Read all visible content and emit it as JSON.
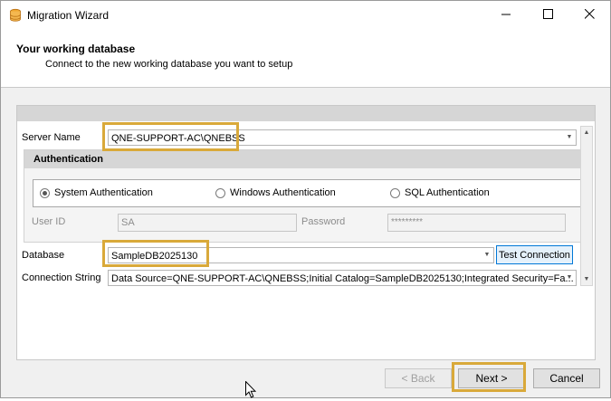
{
  "window": {
    "title": "Migration Wizard"
  },
  "header": {
    "title": "Your working database",
    "subtitle": "Connect to the new working database you want to setup"
  },
  "form": {
    "server_name_label": "Server Name",
    "server_name_value": "QNE-SUPPORT-AC\\QNEBSS",
    "auth_title": "Authentication",
    "auth_options": [
      "System Authentication",
      "Windows Authentication",
      "SQL Authentication"
    ],
    "auth_selected": "System Authentication",
    "user_id_label": "User ID",
    "user_id_value": "SA",
    "password_label": "Password",
    "password_value": "*********",
    "database_label": "Database",
    "database_value": "SampleDB2025130",
    "test_connection_label": "Test Connection",
    "connection_string_label": "Connection String",
    "connection_string_value": "Data Source=QNE-SUPPORT-AC\\QNEBSS;Initial Catalog=SampleDB2025130;Integrated Security=Fa..."
  },
  "footer": {
    "back_label": "< Back",
    "next_label": "Next >",
    "cancel_label": "Cancel"
  },
  "colors": {
    "highlight": "#d9a93a",
    "focus_blue": "#0078d7"
  },
  "icons": {
    "app": "database-icon",
    "minimize": "minimize-icon",
    "maximize": "maximize-icon",
    "close": "close-icon"
  }
}
